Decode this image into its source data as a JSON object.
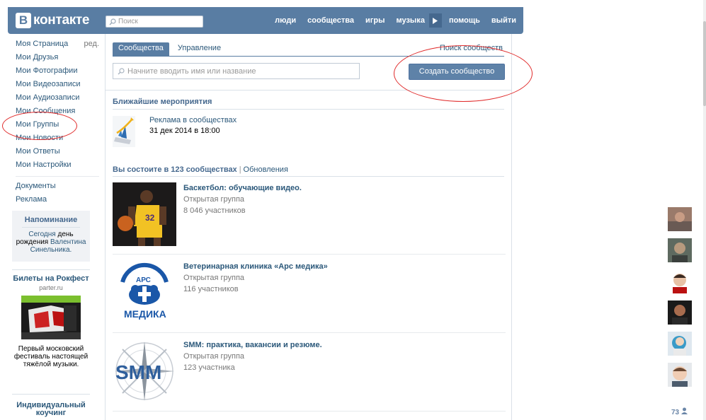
{
  "header": {
    "logo_letter": "В",
    "logo_text": "контакте",
    "search_placeholder": "Поиск",
    "nav": [
      "люди",
      "сообщества",
      "игры",
      "музыка",
      "помощь",
      "выйти"
    ]
  },
  "left_menu": {
    "items": [
      {
        "label": "Моя Страница",
        "edit": "ред."
      },
      {
        "label": "Мои Друзья"
      },
      {
        "label": "Мои Фотографии"
      },
      {
        "label": "Мои Видеозаписи"
      },
      {
        "label": "Мои Аудиозаписи"
      },
      {
        "label": "Мои Сообщения"
      },
      {
        "label": "Мои Группы"
      },
      {
        "label": "Мои Новости"
      },
      {
        "label": "Мои Ответы"
      },
      {
        "label": "Мои Настройки"
      }
    ],
    "extra": [
      {
        "label": "Документы"
      },
      {
        "label": "Реклама"
      }
    ]
  },
  "reminder": {
    "title": "Напоминание",
    "text_1": "Сегодня",
    "text_2": "день рождения",
    "name": "Валентина Синельника."
  },
  "ads": [
    {
      "title": "Билеты на Рокфест",
      "domain": "parter.ru",
      "description": "Первый московский фестиваль настоящей тяжёлой музыки."
    },
    {
      "title": "Индивидуальный коучинг"
    }
  ],
  "main": {
    "tabs": [
      "Сообщества",
      "Управление"
    ],
    "search_communities": "Поиск сообществ",
    "search_placeholder": "Начните вводить имя или название",
    "create_button": "Создать сообщество",
    "events_title": "Ближайшие мероприятия",
    "event": {
      "name": "Реклама в сообществах",
      "date": "31 дек 2014 в 18:00"
    },
    "groups_count_title": "Вы состоите в 123 сообществах",
    "updates_link": "Обновления",
    "groups": [
      {
        "name": "Баскетбол: обучающие видео.",
        "type": "Открытая группа",
        "members": "8 046 участников"
      },
      {
        "name": "Ветеринарная клиника «Арс медика»",
        "type": "Открытая группа",
        "members": "116 участников"
      },
      {
        "name": "SMM: практика, вакансии и резюме.",
        "type": "Открытая группа",
        "members": "123 участника"
      }
    ]
  },
  "right_sidebar": {
    "friends_count": "73"
  },
  "colors": {
    "header_blue": "#597da3",
    "link_blue": "#2b587a",
    "annotation_red": "#e02a2a"
  }
}
